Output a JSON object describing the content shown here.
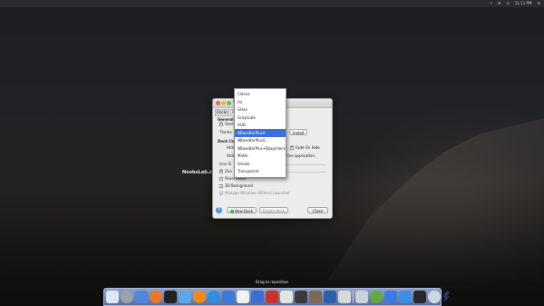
{
  "topbar": {
    "indicators": [
      "•",
      "⚙",
      "⏻",
      "☰"
    ],
    "clock": "11:11 PM"
  },
  "watermark": "NoobsLab.com",
  "dialog": {
    "title": "Do",
    "tabs": [
      "Docks",
      "Pr"
    ],
    "general_label": "General O",
    "start_label": "Start",
    "theme_label": "Theme",
    "install_button": "Install",
    "dock_config_label": "Dock Co",
    "hide_label": "Hide",
    "hide2_label": "Hide",
    "icon_size_label": "Icon Si",
    "fade_on_hide_label": "Fade On Hide",
    "active_app_text": "ctive application.",
    "zoom_label": "Zoo",
    "panel_mode_label": "Panel Mode",
    "bg3d_label": "3D Background",
    "manage_windows_label": "Manage Windows Without Launcher",
    "new_dock_button": "New Dock",
    "delete_dock_button": "Delete dock",
    "close_button": "Close"
  },
  "theme_dropdown": {
    "options": [
      "Classic",
      "Air",
      "Glass",
      "Grayscale",
      "HUD",
      "NBaseBarPlusA",
      "NBaseBarPlusG",
      "NBaseBarPlus+Boxpinlock",
      "Matte",
      "Smoke",
      "Transparent"
    ],
    "selected_index": 5
  },
  "drag_hint": "Drag to reposition",
  "dock": {
    "items": [
      {
        "icon": "show-desktop-icon",
        "color": "#dfe6f5"
      },
      {
        "icon": "system-settings-icon",
        "color": "#9aa3ad"
      },
      {
        "icon": "finder-icon",
        "color": "#4f86e0"
      },
      {
        "icon": "firefox-icon",
        "color": "#e8762b"
      },
      {
        "icon": "terminal-icon",
        "color": "#222222"
      },
      {
        "icon": "files-folder-icon",
        "color": "#5aa7e6"
      },
      {
        "icon": "vlc-icon",
        "color": "#f08a1c"
      },
      {
        "icon": "app-store-icon",
        "color": "#2f8de4"
      },
      {
        "icon": "network-icon",
        "color": "#3c79d8"
      },
      {
        "icon": "calendar-icon",
        "color": "#f1f1f1"
      },
      {
        "icon": "thunderbird-icon",
        "color": "#3b6fd1"
      },
      {
        "icon": "photos-icon",
        "color": "#c8342a"
      },
      {
        "icon": "text-editor-icon",
        "color": "#e4e4e4"
      },
      {
        "icon": "monitor-icon",
        "color": "#3a3a3a"
      },
      {
        "icon": "gimp-icon",
        "color": "#7b6a58"
      },
      {
        "icon": "screenshot-icon",
        "color": "#2b5fae"
      },
      {
        "icon": "printer-icon",
        "color": "#d9d9d9"
      },
      {
        "icon": "trash-icon",
        "color": "#c9d1dc"
      },
      {
        "icon": "disk-icon",
        "color": "#5faa43"
      },
      {
        "icon": "mail-icon",
        "color": "#3c7be0"
      },
      {
        "icon": "desktop-icon",
        "color": "#3d8fe6"
      },
      {
        "icon": "lock-icon",
        "color": "#2a2a2a"
      },
      {
        "icon": "help-icon",
        "color": "#d0d7e3"
      },
      {
        "icon": "dock-settings-icon",
        "color": "#2b3a66"
      }
    ]
  }
}
